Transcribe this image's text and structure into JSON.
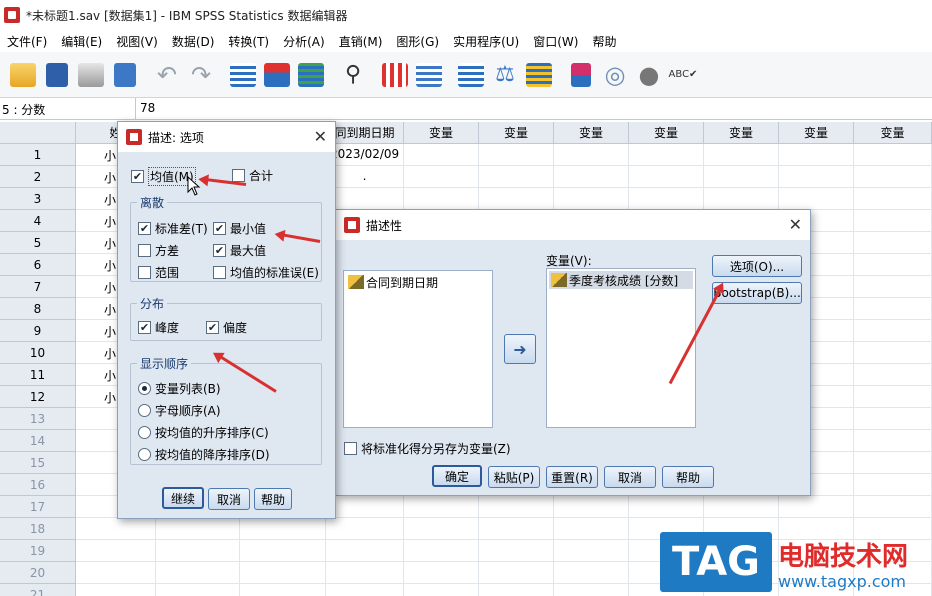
{
  "window": {
    "title": "*未标题1.sav [数据集1] - IBM SPSS Statistics 数据编辑器"
  },
  "menu": [
    "文件(F)",
    "编辑(E)",
    "视图(V)",
    "数据(D)",
    "转换(T)",
    "分析(A)",
    "直销(M)",
    "图形(G)",
    "实用程序(U)",
    "窗口(W)",
    "帮助"
  ],
  "toolbar_icons": [
    "open-folder-icon",
    "save-icon",
    "print-icon",
    "dialog-recall-icon",
    "undo-icon",
    "redo-icon",
    "goto-case-icon",
    "goto-variable-icon",
    "variables-icon",
    "find-icon",
    "insert-cases-icon",
    "insert-variable-icon",
    "split-file-icon",
    "weight-cases-icon",
    "select-cases-icon",
    "value-labels-icon",
    "use-sets-icon",
    "show-all-variables-icon",
    "spell-check-icon"
  ],
  "cellbar": {
    "ref": "5 : 分数",
    "value": "78"
  },
  "grid": {
    "col_headers": [
      "姓",
      "",
      "",
      "同到期日期",
      "变量",
      "变量",
      "变量",
      "变量",
      "变量",
      "变量",
      "变量"
    ],
    "rows": [
      "1",
      "2",
      "3",
      "4",
      "5",
      "6",
      "7",
      "8",
      "9",
      "10",
      "11",
      "12",
      "13",
      "14",
      "15",
      "16",
      "17",
      "18",
      "19",
      "20",
      "21"
    ],
    "col_a": [
      "小",
      "小",
      "小",
      "小",
      "小",
      "小",
      "小",
      "小",
      "小",
      "小",
      "小",
      "小"
    ],
    "col_d": [
      "2023/02/09",
      "."
    ]
  },
  "options_dialog": {
    "title": "描述: 选项",
    "mean": {
      "label": "均值(M)",
      "checked": true
    },
    "sum": {
      "label": "合计",
      "checked": false
    },
    "dispersion": {
      "title": "离散",
      "items": [
        {
          "label": "标准差(T)",
          "checked": true
        },
        {
          "label": "最小值",
          "checked": true
        },
        {
          "label": "方差",
          "checked": false
        },
        {
          "label": "最大值",
          "checked": true
        },
        {
          "label": "范围",
          "checked": false
        },
        {
          "label": "均值的标准误(E)",
          "checked": false
        }
      ]
    },
    "distribution": {
      "title": "分布",
      "items": [
        {
          "label": "峰度",
          "checked": true
        },
        {
          "label": "偏度",
          "checked": true
        }
      ]
    },
    "display_order": {
      "title": "显示顺序",
      "items": [
        {
          "label": "变量列表(B)",
          "selected": true
        },
        {
          "label": "字母顺序(A)",
          "selected": false
        },
        {
          "label": "按均值的升序排序(C)",
          "selected": false
        },
        {
          "label": "按均值的降序排序(D)",
          "selected": false
        }
      ]
    },
    "buttons": {
      "continue": "继续",
      "cancel": "取消",
      "help": "帮助"
    }
  },
  "desc_dialog": {
    "title": "描述性",
    "source_list": [
      "合同到期日期"
    ],
    "variables_label": "变量(V):",
    "target_list": [
      "季度考核成绩 [分数]"
    ],
    "save_std": {
      "label": "将标准化得分另存为变量(Z)",
      "checked": false
    },
    "side_buttons": {
      "options": "选项(O)...",
      "bootstrap": "Bootstrap(B)..."
    },
    "buttons": {
      "ok": "确定",
      "paste": "粘贴(P)",
      "reset": "重置(R)",
      "cancel": "取消",
      "help": "帮助"
    }
  },
  "watermark": {
    "tag": "TAG",
    "site_name": "电脑技术网",
    "url": "www.tagxp.com"
  }
}
